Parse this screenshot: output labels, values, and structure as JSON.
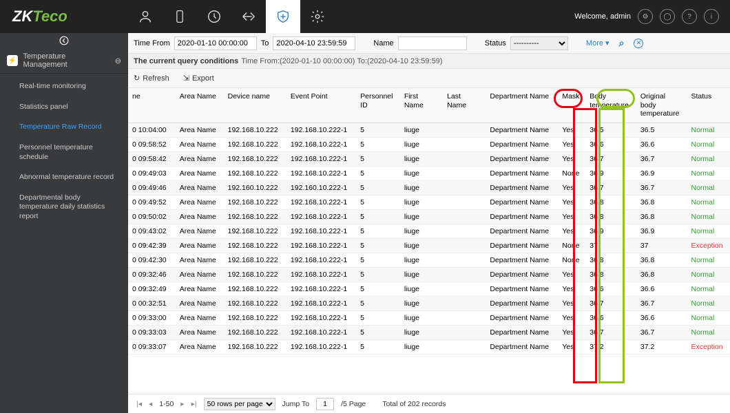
{
  "header": {
    "logo_prefix": "ZK",
    "logo_suffix": "Teco",
    "welcome": "Welcome, admin"
  },
  "sidebar": {
    "title": "Temperature Management",
    "items": [
      "Real-time monitoring",
      "Statistics panel",
      "Temperature Raw Record",
      "Personnel temperature schedule",
      "Abnormal temperature record",
      "Departmental body temperature daily statistics report"
    ]
  },
  "filter": {
    "time_from_label": "Time From",
    "time_from": "2020-01-10 00:00:00",
    "to_label": "To",
    "time_to": "2020-04-10 23:59:59",
    "name_label": "Name",
    "name": "",
    "status_label": "Status",
    "status": "----------",
    "more": "More",
    "cond_label": "The current query conditions",
    "cond_text": "Time From:(2020-01-10 00:00:00)  To:(2020-04-10 23:59:59)"
  },
  "toolbar": {
    "refresh": "Refresh",
    "export": "Export"
  },
  "columns": [
    "ne",
    "Area Name",
    "Device name",
    "Event Point",
    "Personnel ID",
    "First Name",
    "Last Name",
    "Department Name",
    "Mask",
    "Body temperature",
    "Original body temperature",
    "Status"
  ],
  "rows": [
    {
      "t": "0 10:04:00",
      "a": "Area Name",
      "d": "192.168.10.222",
      "e": "192.168.10.222-1",
      "p": "5",
      "f": "liuge",
      "l": "",
      "dep": "Department Name",
      "m": "Yes",
      "bt": "36.5",
      "ob": "36.5",
      "s": "Normal"
    },
    {
      "t": "0 09:58:52",
      "a": "Area Name",
      "d": "192.168.10.222",
      "e": "192.168.10.222-1",
      "p": "5",
      "f": "liuge",
      "l": "",
      "dep": "Department Name",
      "m": "Yes",
      "bt": "36.6",
      "ob": "36.6",
      "s": "Normal"
    },
    {
      "t": "0 09:58:42",
      "a": "Area Name",
      "d": "192.168.10.222",
      "e": "192.168.10.222-1",
      "p": "5",
      "f": "liuge",
      "l": "",
      "dep": "Department Name",
      "m": "Yes",
      "bt": "36.7",
      "ob": "36.7",
      "s": "Normal"
    },
    {
      "t": "0 09:49:03",
      "a": "Area Name",
      "d": "192.168.10.222",
      "e": "192.168.10.222-1",
      "p": "5",
      "f": "liuge",
      "l": "",
      "dep": "Department Name",
      "m": "None",
      "bt": "36.9",
      "ob": "36.9",
      "s": "Normal"
    },
    {
      "t": "0 09:49:46",
      "a": "Area Name",
      "d": "192.160.10.222",
      "e": "192.160.10.222-1",
      "p": "5",
      "f": "liuge",
      "l": "",
      "dep": "Department Name",
      "m": "Yes",
      "bt": "36.7",
      "ob": "36.7",
      "s": "Normal"
    },
    {
      "t": "0 09:49:52",
      "a": "Area Name",
      "d": "192.168.10.222",
      "e": "192.168.10.222-1",
      "p": "5",
      "f": "liuge",
      "l": "",
      "dep": "Department Name",
      "m": "Yes",
      "bt": "36.8",
      "ob": "36.8",
      "s": "Normal"
    },
    {
      "t": "0 09:50:02",
      "a": "Area Name",
      "d": "192.168.10.222",
      "e": "192.168.10.222-1",
      "p": "5",
      "f": "liuge",
      "l": "",
      "dep": "Department Name",
      "m": "Yes",
      "bt": "36.8",
      "ob": "36.8",
      "s": "Normal"
    },
    {
      "t": "0 09:43:02",
      "a": "Area Name",
      "d": "192.168.10.222",
      "e": "192.168.10.222-1",
      "p": "5",
      "f": "liuge",
      "l": "",
      "dep": "Department Name",
      "m": "Yes",
      "bt": "36.9",
      "ob": "36.9",
      "s": "Normal"
    },
    {
      "t": "0 09:42:39",
      "a": "Area Name",
      "d": "192.168.10.222",
      "e": "192.168.10.222-1",
      "p": "5",
      "f": "liuge",
      "l": "",
      "dep": "Department Name",
      "m": "None",
      "bt": "37",
      "ob": "37",
      "s": "Exception"
    },
    {
      "t": "0 09:42:30",
      "a": "Area Name",
      "d": "192.168.10.222",
      "e": "192.168.10.222-1",
      "p": "5",
      "f": "liuge",
      "l": "",
      "dep": "Department Name",
      "m": "None",
      "bt": "36.8",
      "ob": "36.8",
      "s": "Normal"
    },
    {
      "t": "0 09:32:46",
      "a": "Area Name",
      "d": "192.168.10.222",
      "e": "192.168.10.222-1",
      "p": "5",
      "f": "liuge",
      "l": "",
      "dep": "Department Name",
      "m": "Yes",
      "bt": "36.8",
      "ob": "36.8",
      "s": "Normal"
    },
    {
      "t": "0 09:32:49",
      "a": "Area Name",
      "d": "192.168.10.222",
      "e": "192.168.10.222-1",
      "p": "5",
      "f": "liuge",
      "l": "",
      "dep": "Department Name",
      "m": "Yes",
      "bt": "36.6",
      "ob": "36.6",
      "s": "Normal"
    },
    {
      "t": "0 00:32:51",
      "a": "Area Name",
      "d": "192.168.10.222",
      "e": "192.168.10.222-1",
      "p": "5",
      "f": "liuge",
      "l": "",
      "dep": "Department Name",
      "m": "Yes",
      "bt": "36.7",
      "ob": "36.7",
      "s": "Normal"
    },
    {
      "t": "0 09:33:00",
      "a": "Area Name",
      "d": "192.168.10.222",
      "e": "192.168.10.222-1",
      "p": "5",
      "f": "liuge",
      "l": "",
      "dep": "Department Name",
      "m": "Yes",
      "bt": "36.6",
      "ob": "36.6",
      "s": "Normal"
    },
    {
      "t": "0 09:33:03",
      "a": "Area Name",
      "d": "192.168.10.222",
      "e": "192.168.10.222-1",
      "p": "5",
      "f": "liuge",
      "l": "",
      "dep": "Department Name",
      "m": "Yes",
      "bt": "36.7",
      "ob": "36.7",
      "s": "Normal"
    },
    {
      "t": "0 09:33:07",
      "a": "Area Name",
      "d": "192.168.10.222",
      "e": "192.168.10.222-1",
      "p": "5",
      "f": "liuge",
      "l": "",
      "dep": "Department Name",
      "m": "Yes",
      "bt": "37.2",
      "ob": "37.2",
      "s": "Exception"
    }
  ],
  "pager": {
    "range": "1-50",
    "perpage": "50 rows per page",
    "jump": "Jump To",
    "page": "1",
    "total_pages": "/5 Page",
    "total": "Total of 202 records"
  }
}
